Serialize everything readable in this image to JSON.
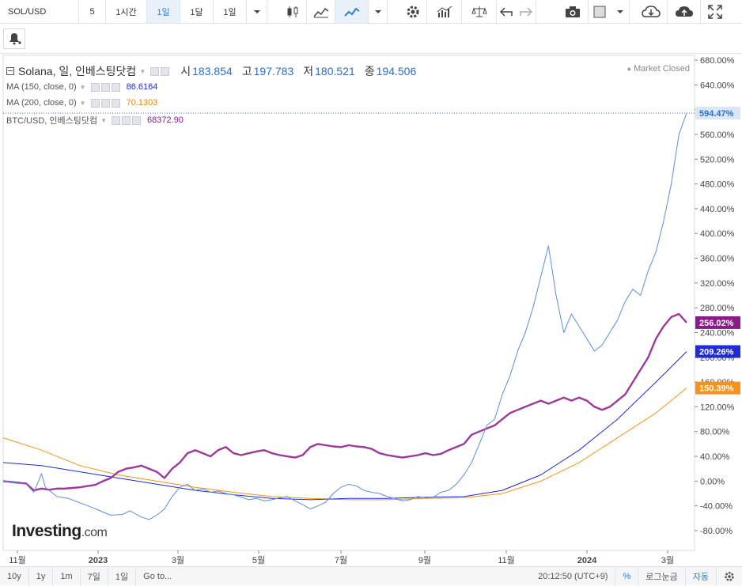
{
  "toolbar": {
    "symbol": "SOL/USD",
    "intervals": [
      "5",
      "1시간",
      "1일",
      "1달",
      "1일"
    ],
    "active_interval": 2,
    "icons": [
      "chevron-down-icon",
      "candlestick-icon",
      "area-chart-icon",
      "line-chart-icon",
      "chevron-down-icon",
      "gear-icon",
      "bar-chart-icon",
      "scale-icon",
      "undo-icon",
      "redo-icon",
      "camera-icon",
      "color-box-icon",
      "chevron-down-icon",
      "cloud-download-icon",
      "cloud-upload-icon",
      "fullscreen-icon"
    ]
  },
  "legend": {
    "main": {
      "name": "Solana, 일, 인베스팅닷컴",
      "o_label": "시",
      "o": "183.854",
      "h_label": "고",
      "h": "197.783",
      "l_label": "저",
      "l": "180.521",
      "c_label": "종",
      "c": "194.506"
    },
    "ma150": {
      "name": "MA (150, close, 0)",
      "value": "86.6164",
      "color": "#1e2bd6"
    },
    "ma200": {
      "name": "MA (200, close, 0)",
      "value": "70.1303",
      "color": "#f7931a"
    },
    "btc": {
      "name": "BTC/USD, 인베스팅닷컴",
      "value": "68372.90",
      "color": "#8b1a8b"
    },
    "market_status": "Market Closed"
  },
  "price_axis": {
    "labels": [
      "680.00%",
      "640.00%",
      "600.00%",
      "560.00%",
      "520.00%",
      "480.00%",
      "440.00%",
      "400.00%",
      "360.00%",
      "320.00%",
      "280.00%",
      "240.00%",
      "200.00%",
      "160.00%",
      "120.00%",
      "80.00%",
      "40.00%",
      "0.00%",
      "-40.00%",
      "-80.00%"
    ],
    "badges": [
      {
        "text": "594.47%",
        "value": 594.47,
        "bg": "#dbe7f7",
        "fg": "#2a6fc9"
      },
      {
        "text": "256.02%",
        "value": 256.02,
        "bg": "#8b1a8b",
        "fg": "#ffffff"
      },
      {
        "text": "209.26%",
        "value": 209.26,
        "bg": "#1e2bd6",
        "fg": "#ffffff"
      },
      {
        "text": "150.39%",
        "value": 150.39,
        "bg": "#f7931a",
        "fg": "#ffffff"
      }
    ]
  },
  "time_axis": {
    "labels": [
      "11월",
      "2023",
      "3월",
      "5월",
      "7월",
      "9월",
      "11월",
      "2024",
      "3월"
    ]
  },
  "brand": {
    "name": "Investing",
    "suffix": ".com"
  },
  "bottombar": {
    "ranges": [
      "10y",
      "1y",
      "1m",
      "7일",
      "1일",
      "Go to..."
    ],
    "time": "20:12:50 (UTC+9)",
    "percent": "%",
    "log": "로그눈금",
    "auto": "자동"
  },
  "chart_data": {
    "type": "line",
    "y_unit": "%",
    "ylim": [
      -100,
      690
    ],
    "x_range": [
      "2022-11",
      "2024-03"
    ],
    "series": [
      {
        "name": "SOL/USD",
        "color": "#5b8fd6",
        "points": [
          [
            0,
            0
          ],
          [
            3,
            -3
          ],
          [
            6,
            -5
          ],
          [
            8,
            -18
          ],
          [
            10,
            12
          ],
          [
            11,
            -10
          ],
          [
            14,
            -25
          ],
          [
            17,
            -28
          ],
          [
            20,
            -35
          ],
          [
            23,
            -42
          ],
          [
            26,
            -50
          ],
          [
            28,
            -55
          ],
          [
            31,
            -54
          ],
          [
            33,
            -48
          ],
          [
            36,
            -58
          ],
          [
            38,
            -62
          ],
          [
            40,
            -55
          ],
          [
            42,
            -45
          ],
          [
            44,
            -25
          ],
          [
            46,
            -10
          ],
          [
            48,
            -5
          ],
          [
            50,
            -15
          ],
          [
            52,
            -12
          ],
          [
            54,
            -18
          ],
          [
            56,
            -16
          ],
          [
            58,
            -20
          ],
          [
            60,
            -22
          ],
          [
            62,
            -26
          ],
          [
            64,
            -30
          ],
          [
            66,
            -28
          ],
          [
            68,
            -32
          ],
          [
            70,
            -30
          ],
          [
            72,
            -27
          ],
          [
            74,
            -25
          ],
          [
            76,
            -32
          ],
          [
            78,
            -38
          ],
          [
            80,
            -45
          ],
          [
            82,
            -40
          ],
          [
            84,
            -34
          ],
          [
            86,
            -20
          ],
          [
            88,
            -10
          ],
          [
            90,
            -5
          ],
          [
            92,
            -8
          ],
          [
            94,
            -15
          ],
          [
            96,
            -18
          ],
          [
            98,
            -20
          ],
          [
            100,
            -25
          ],
          [
            102,
            -28
          ],
          [
            104,
            -32
          ],
          [
            106,
            -30
          ],
          [
            108,
            -25
          ],
          [
            110,
            -27
          ],
          [
            112,
            -26
          ],
          [
            114,
            -18
          ],
          [
            116,
            -15
          ],
          [
            118,
            -5
          ],
          [
            120,
            10
          ],
          [
            122,
            30
          ],
          [
            124,
            60
          ],
          [
            126,
            90
          ],
          [
            128,
            100
          ],
          [
            130,
            140
          ],
          [
            132,
            170
          ],
          [
            134,
            210
          ],
          [
            136,
            240
          ],
          [
            138,
            280
          ],
          [
            140,
            330
          ],
          [
            142,
            380
          ],
          [
            144,
            300
          ],
          [
            146,
            240
          ],
          [
            148,
            270
          ],
          [
            150,
            250
          ],
          [
            152,
            230
          ],
          [
            154,
            210
          ],
          [
            156,
            220
          ],
          [
            158,
            240
          ],
          [
            160,
            260
          ],
          [
            162,
            290
          ],
          [
            164,
            310
          ],
          [
            166,
            300
          ],
          [
            168,
            340
          ],
          [
            170,
            370
          ],
          [
            172,
            420
          ],
          [
            174,
            480
          ],
          [
            176,
            560
          ],
          [
            178,
            594.47
          ]
        ]
      },
      {
        "name": "BTC/USD",
        "color": "#9b3a9b",
        "points": [
          [
            0,
            0
          ],
          [
            3,
            -2
          ],
          [
            6,
            -4
          ],
          [
            8,
            -15
          ],
          [
            10,
            -12
          ],
          [
            12,
            -14
          ],
          [
            14,
            -12
          ],
          [
            16,
            -12
          ],
          [
            18,
            -11
          ],
          [
            20,
            -10
          ],
          [
            22,
            -8
          ],
          [
            24,
            -6
          ],
          [
            26,
            0
          ],
          [
            28,
            5
          ],
          [
            30,
            15
          ],
          [
            32,
            20
          ],
          [
            34,
            22
          ],
          [
            36,
            25
          ],
          [
            38,
            20
          ],
          [
            40,
            15
          ],
          [
            42,
            5
          ],
          [
            44,
            20
          ],
          [
            46,
            30
          ],
          [
            48,
            45
          ],
          [
            50,
            50
          ],
          [
            52,
            45
          ],
          [
            54,
            40
          ],
          [
            56,
            50
          ],
          [
            58,
            55
          ],
          [
            60,
            45
          ],
          [
            62,
            42
          ],
          [
            64,
            45
          ],
          [
            66,
            48
          ],
          [
            68,
            50
          ],
          [
            70,
            45
          ],
          [
            72,
            42
          ],
          [
            74,
            40
          ],
          [
            76,
            38
          ],
          [
            78,
            42
          ],
          [
            80,
            55
          ],
          [
            82,
            60
          ],
          [
            84,
            58
          ],
          [
            86,
            56
          ],
          [
            88,
            55
          ],
          [
            90,
            58
          ],
          [
            92,
            56
          ],
          [
            94,
            55
          ],
          [
            96,
            52
          ],
          [
            98,
            45
          ],
          [
            100,
            42
          ],
          [
            102,
            40
          ],
          [
            104,
            38
          ],
          [
            106,
            40
          ],
          [
            108,
            42
          ],
          [
            110,
            45
          ],
          [
            112,
            42
          ],
          [
            114,
            44
          ],
          [
            116,
            50
          ],
          [
            118,
            55
          ],
          [
            120,
            60
          ],
          [
            122,
            75
          ],
          [
            124,
            80
          ],
          [
            126,
            85
          ],
          [
            128,
            90
          ],
          [
            130,
            100
          ],
          [
            132,
            110
          ],
          [
            134,
            115
          ],
          [
            136,
            120
          ],
          [
            138,
            125
          ],
          [
            140,
            130
          ],
          [
            142,
            125
          ],
          [
            144,
            130
          ],
          [
            146,
            135
          ],
          [
            148,
            130
          ],
          [
            150,
            135
          ],
          [
            152,
            130
          ],
          [
            154,
            120
          ],
          [
            156,
            115
          ],
          [
            158,
            120
          ],
          [
            160,
            130
          ],
          [
            162,
            140
          ],
          [
            164,
            160
          ],
          [
            166,
            180
          ],
          [
            168,
            200
          ],
          [
            170,
            230
          ],
          [
            172,
            250
          ],
          [
            174,
            265
          ],
          [
            176,
            270
          ],
          [
            178,
            256.02
          ]
        ]
      },
      {
        "name": "MA (150, close, 0)",
        "color": "#1e2bd6",
        "points": [
          [
            0,
            30
          ],
          [
            10,
            25
          ],
          [
            20,
            15
          ],
          [
            30,
            5
          ],
          [
            40,
            -5
          ],
          [
            50,
            -15
          ],
          [
            60,
            -22
          ],
          [
            70,
            -28
          ],
          [
            80,
            -30
          ],
          [
            90,
            -28
          ],
          [
            100,
            -28
          ],
          [
            110,
            -26
          ],
          [
            120,
            -25
          ],
          [
            130,
            -15
          ],
          [
            140,
            10
          ],
          [
            150,
            50
          ],
          [
            160,
            100
          ],
          [
            170,
            160
          ],
          [
            178,
            209.26
          ]
        ]
      },
      {
        "name": "MA (200, close, 0)",
        "color": "#f7931a",
        "points": [
          [
            0,
            70
          ],
          [
            10,
            50
          ],
          [
            20,
            25
          ],
          [
            30,
            10
          ],
          [
            40,
            0
          ],
          [
            50,
            -10
          ],
          [
            60,
            -18
          ],
          [
            70,
            -25
          ],
          [
            80,
            -28
          ],
          [
            90,
            -30
          ],
          [
            100,
            -30
          ],
          [
            110,
            -28
          ],
          [
            120,
            -27
          ],
          [
            130,
            -20
          ],
          [
            140,
            0
          ],
          [
            150,
            30
          ],
          [
            160,
            70
          ],
          [
            170,
            110
          ],
          [
            178,
            150.39
          ]
        ]
      }
    ]
  }
}
